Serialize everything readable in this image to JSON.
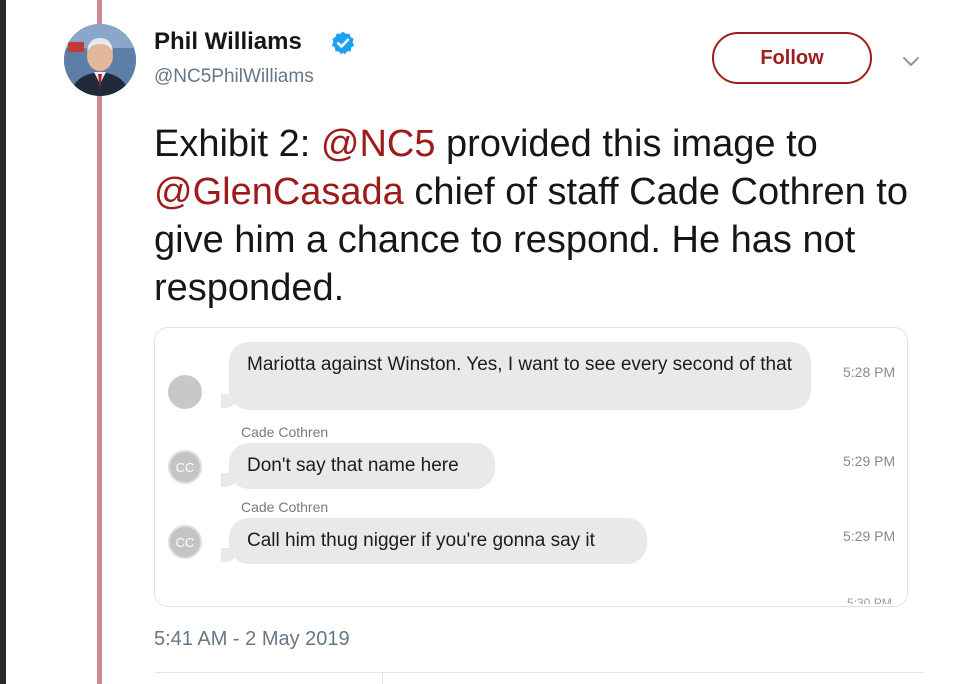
{
  "author": {
    "name": "Phil Williams",
    "handle": "@NC5PhilWilliams"
  },
  "actions": {
    "follow_label": "Follow"
  },
  "tweet": {
    "text_parts": [
      "Exhibit 2: ",
      "@NC5",
      " provided this image to ",
      "@GlenCasada",
      " chief of staff Cade Cothren to give him a chance to respond. He has not responded."
    ],
    "timestamp": "5:41 AM - 2 May 2019"
  },
  "media": {
    "messages": [
      {
        "sender": "",
        "avatar_initials": "",
        "text": "Mariotta against Winston. Yes, I want to see every second of that",
        "time": "5:28 PM"
      },
      {
        "sender": "Cade Cothren",
        "avatar_initials": "CC",
        "text": "Don't say that name here",
        "time": "5:29 PM"
      },
      {
        "sender": "Cade Cothren",
        "avatar_initials": "CC",
        "text": "Call him thug nigger if you're gonna say it",
        "time": "5:29 PM"
      }
    ],
    "cut_off_time": "5:30 PM"
  },
  "colors": {
    "mention": "#9e1b1b",
    "follow_accent": "#a01c1c",
    "thread_line": "#c98b96",
    "verified": "#1da1f2"
  },
  "icons": {
    "verified": "verified-badge-icon",
    "menu": "chevron-down-icon"
  }
}
